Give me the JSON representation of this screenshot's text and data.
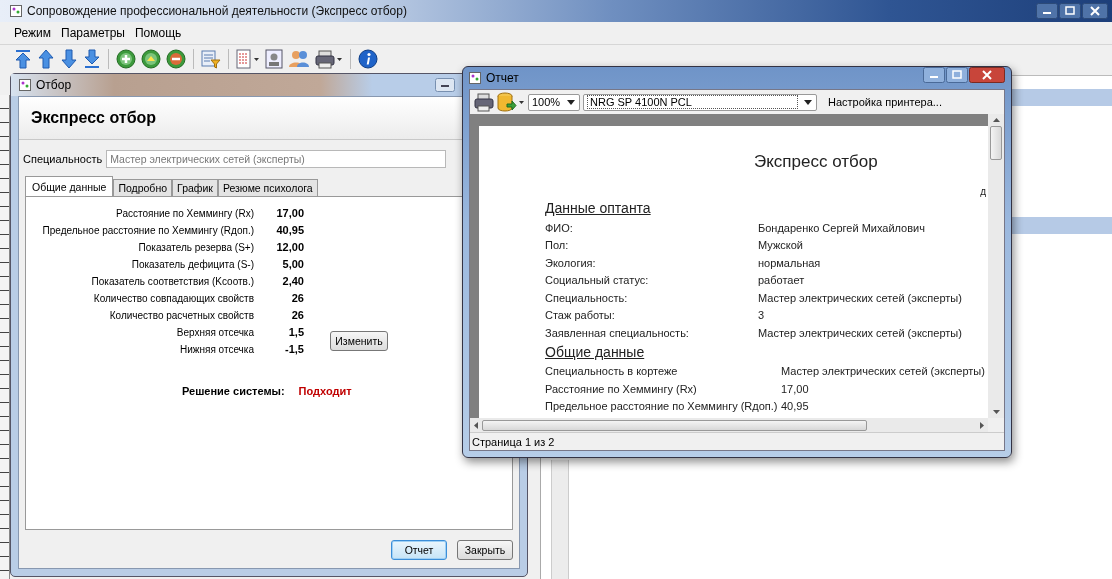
{
  "window": {
    "title": "Сопровождение профессиональной деятельности (Экспресс отбор)"
  },
  "menu": [
    "Режим",
    "Параметры",
    "Помощь"
  ],
  "selection_window": {
    "title": "Отбор",
    "heading": "Экспресс отбор",
    "specialty": {
      "label": "Специальность",
      "value": "Мастер электрических сетей (эксперты)"
    },
    "tabs": [
      {
        "label": "Общие данные",
        "selected": true
      },
      {
        "label": "Подробно",
        "selected": false
      },
      {
        "label": "График",
        "selected": false
      },
      {
        "label": "Резюме психолога",
        "selected": false
      }
    ],
    "metrics": [
      {
        "label": "Расстояние по Хеммингу (Rx)",
        "value": "17,00"
      },
      {
        "label": "Предельное расстояние по Хеммингу (Rдоп.)",
        "value": "40,95"
      },
      {
        "label": "Показатель резерва (S+)",
        "value": "12,00"
      },
      {
        "label": "Показатель дефицита (S-)",
        "value": "5,00"
      },
      {
        "label": "Показатель соответствия (Kсоотв.)",
        "value": "2,40"
      },
      {
        "label": "Количество совпадающих свойств",
        "value": "26"
      },
      {
        "label": "Количество расчетных свойств",
        "value": "26"
      },
      {
        "label": "Верхняя отсечка",
        "value": "1,5"
      },
      {
        "label": "Нижняя отсечка",
        "value": "-1,5"
      }
    ],
    "change_button": "Изменить",
    "decision": {
      "label": "Решение системы:",
      "value": "Подходит"
    },
    "buttons": [
      {
        "label": "Отчет",
        "default": true
      },
      {
        "label": "Закрыть",
        "default": false
      }
    ]
  },
  "report_window": {
    "title": "Отчет",
    "zoom": "100%",
    "printer": "NRG SP 4100N PCL",
    "printer_settings": "Настройка принтера...",
    "page": {
      "title": "Экспресс отбор",
      "edge_text": "д",
      "sections": [
        {
          "heading": "Данные оптанта",
          "rows": [
            {
              "label": "ФИО:",
              "value": "Бондаренко Сергей Михайлович"
            },
            {
              "label": "Пол:",
              "value": "Мужской"
            },
            {
              "label": "Экология:",
              "value": "нормальная"
            },
            {
              "label": "Социальный статус:",
              "value": "работает"
            },
            {
              "label": "Специальность:",
              "value": "Мастер электрических сетей (эксперты)"
            },
            {
              "label": "Стаж работы:",
              "value": "3"
            },
            {
              "label": "Заявленная специальность:",
              "value": "Мастер электрических сетей (эксперты)"
            }
          ]
        },
        {
          "heading": "Общие данные",
          "rows": [
            {
              "label": "Специальность в кортеже",
              "value": "Мастер электрических сетей (эксперты)"
            },
            {
              "label": "Расстояние по Хеммингу (Rx)",
              "value": "17,00"
            },
            {
              "label": "Предельное расстояние по Хеммингу (Rдоп.)",
              "value": "40,95"
            }
          ]
        }
      ]
    },
    "status": "Страница 1 из 2"
  }
}
